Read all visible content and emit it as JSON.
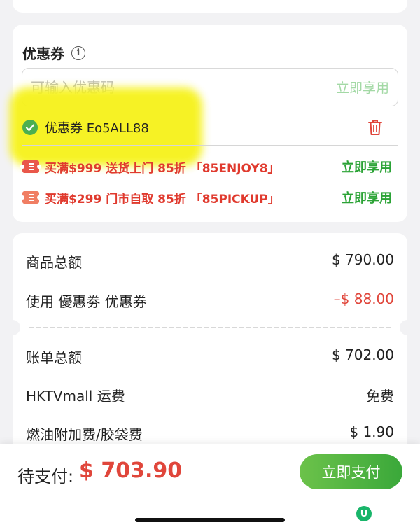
{
  "coupon_section": {
    "title": "优惠券",
    "input_placeholder": "可输入优惠码",
    "apply_label": "立即享用",
    "applied_coupon": "优惠券 Eo5ALL88",
    "promotions": [
      {
        "text": "买满$999 送货上门 85折 「85ENJOY8」",
        "action": "立即享用"
      },
      {
        "text": "买满$299 门市自取 85折 「85PICKUP」",
        "action": "立即享用"
      }
    ]
  },
  "summary": {
    "subtotal_label": "商品总额",
    "subtotal_value": "$ 790.00",
    "discount_label": "使用 優惠劵 优惠券",
    "discount_value": "–$ 88.00",
    "bill_total_label": "账单总额",
    "bill_total_value": "$ 702.00",
    "shipping_label": "HKTVmall 运费",
    "shipping_value": "免费",
    "surcharge_label": "燃油附加费/胶袋费",
    "surcharge_value": "$ 1.90"
  },
  "checkout": {
    "pay_label": "待支付:",
    "pay_amount": "$ 703.90",
    "pay_button": "立即支付"
  },
  "colors": {
    "accent_green": "#3aa83a",
    "price_red": "#e0463b",
    "highlight_yellow": "#f6f21a"
  }
}
